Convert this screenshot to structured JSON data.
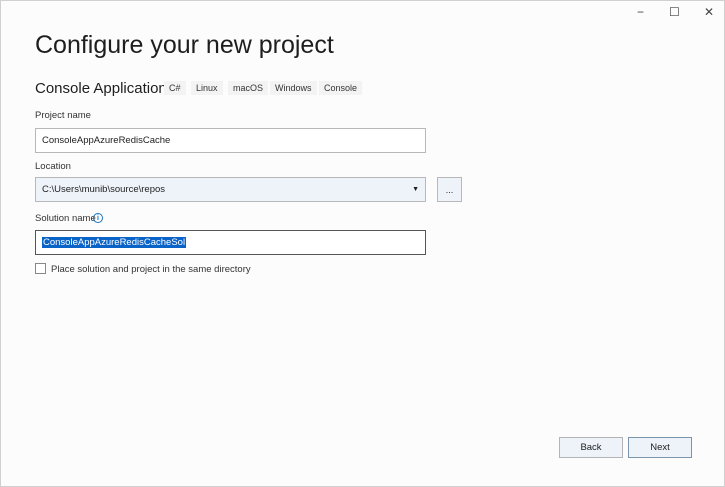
{
  "window": {
    "minimize": "−",
    "maximize": "☐",
    "close": "✕"
  },
  "title": "Configure your new project",
  "template": {
    "name": "Console Application",
    "tags": [
      "C#",
      "Linux",
      "macOS",
      "Windows",
      "Console"
    ]
  },
  "project_name": {
    "label": "Project name",
    "value": "ConsoleAppAzureRedisCache"
  },
  "location": {
    "label": "Location",
    "value": "C:\\Users\\munib\\source\\repos",
    "browse": "..."
  },
  "solution_name": {
    "label": "Solution name",
    "value": "ConsoleAppAzureRedisCacheSol",
    "info": "i"
  },
  "same_dir": {
    "label": "Place solution and project in the same directory",
    "checked": false
  },
  "buttons": {
    "back": "Back",
    "next": "Next"
  }
}
